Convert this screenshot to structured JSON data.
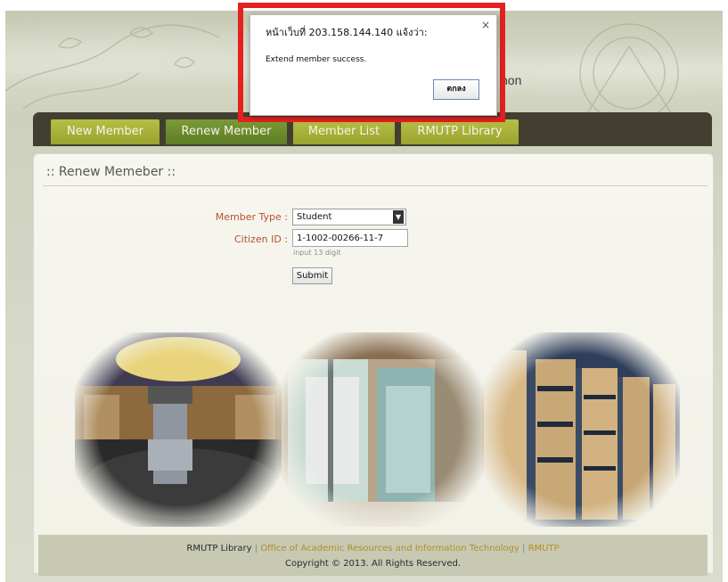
{
  "header": {
    "title_fragment": "hon"
  },
  "nav": {
    "tabs": [
      {
        "label": "New Member"
      },
      {
        "label": "Renew Member"
      },
      {
        "label": "Member List"
      },
      {
        "label": "RMUTP Library"
      }
    ],
    "active": "Renew Member"
  },
  "section": {
    "title": ":: Renew Memeber ::"
  },
  "form": {
    "member_type_label": "Member Type :",
    "member_type_value": "Student",
    "citizen_id_label": "Citizen ID :",
    "citizen_id_value": "1-1002-00266-11-7",
    "citizen_id_hint": "input 13 digit",
    "submit_label": "Submit"
  },
  "footer": {
    "site": "RMUTP Library",
    "sep1": "|",
    "office": "Office of Academic Resources and Information Technology",
    "sep2": "|",
    "org": "RMUTP",
    "copyright": "Copyright © 2013. All Rights Reserved."
  },
  "alert": {
    "title": "หน้าเว็บที่ 203.158.144.140 แจ้งว่า:",
    "close": "×",
    "message": "Extend member success.",
    "ok_label": "ตกลง"
  },
  "colors": {
    "nav_bg": "#423f30",
    "tab_green": "#b6bf45",
    "tab_active": "#7a9b36",
    "label_orange": "#b5512b",
    "highlight_red": "#e5201f"
  }
}
